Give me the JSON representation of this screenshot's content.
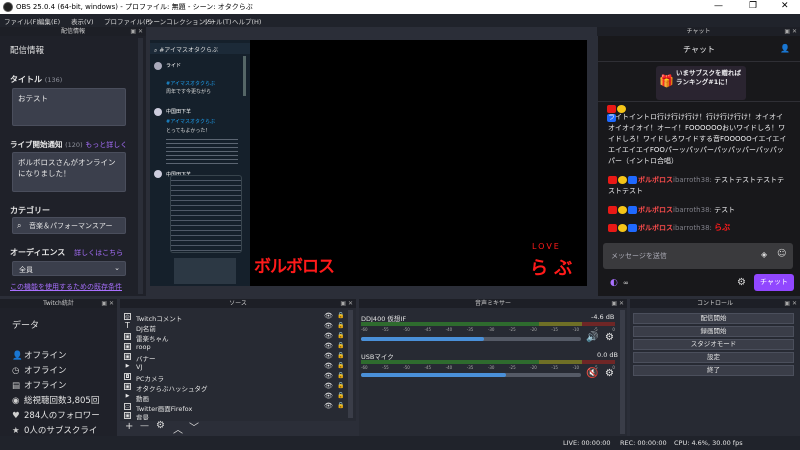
{
  "window": {
    "title": "OBS 25.0.4 (64-bit, windows) - プロファイル: 無題 - シーン: オタクらぶ",
    "controls": [
      "—",
      "❐",
      "✕"
    ]
  },
  "menu": [
    "ファイル(F)",
    "編集(E)",
    "表示(V)",
    "プロファイル(P)",
    "シーンコレクション(S)",
    "ツール(T)",
    "ヘルプ(H)"
  ],
  "stream_info": {
    "dock_title": "配信情報",
    "section_title": "配信情報",
    "title_label": "タイトル",
    "title_count": "(136)",
    "title_value": "おテスト",
    "notify_label": "ライブ開始通知",
    "notify_count": "(120)",
    "notify_more": "もっと詳しく",
    "notify_value": "ボルボロスさんがオンラインになりました！",
    "category_label": "カテゴリー",
    "category_value": "音楽＆パフォーマンスアー",
    "audience_label": "オーディエンス",
    "audience_more": "詳しくはこちら",
    "audience_value": "全員",
    "footer_text": "この機能を使用するための既存条件"
  },
  "preview": {
    "tweet_header": "#アイマスオタクらぶ",
    "tweet_names": [
      "ライド",
      "中国田下羊",
      "中国田下羊"
    ],
    "tweet_tags": [
      "#アイマスオタクらぶ",
      "#アイマスオタクらぶ"
    ],
    "tweet_text_1": "周年です今更ながら",
    "tweet_text_2": "とってもよかった！",
    "overlay_left": "ボルボロス",
    "overlay_love": "LOVE",
    "overlay_right": "ら ぶ"
  },
  "chat": {
    "dock_title": "チャット",
    "header": "チャット",
    "promo": "いまサブスクを贈ればランキング#1に！",
    "lines": [
      "ライトイントロ行け行け行け！行け行け行け！オイオイオイオイオイ！オーイ！FOOOOOOおいワイドしろ！ワイドしろ！ワイドしろワイドする音FOOOOOイエイエイエイエイエイFOOパーッパッパーパッパッパーパッパッパー（イントロ合唱）",
      "ボルボロス",
      "ibarroth38",
      "テストテストテストテストテスト",
      "ボルボロス",
      "ibarroth38",
      "テスト",
      "ボルボロス",
      "ibarroth38",
      "らぶ"
    ],
    "input_placeholder": "メッセージを送信",
    "points": "∞",
    "send_label": "チャット",
    "love_word": "らぶ"
  },
  "twitch_stats": {
    "dock_title": "Twitch統計",
    "tab": "データ",
    "rows": [
      "オフライン",
      "オフライン",
      "オフライン",
      "総視聴回数3,805回",
      "284人のフォロワー",
      "0人のサブスクライ"
    ]
  },
  "sources": {
    "dock_title": "ソース",
    "items": [
      "Twitchコメント",
      "DJ名前",
      "雷楽ちゃん",
      "roop",
      "バナー",
      "VJ",
      "PCカメラ",
      "オタクらぶハッシュタグ",
      "動画",
      "Twitter画面Firefox",
      "背景"
    ],
    "toolbar": [
      "+",
      "—",
      "⚙",
      "︿",
      "﹀"
    ]
  },
  "mixer": {
    "dock_title": "音声ミキサー",
    "tracks": [
      {
        "name": "DDJ400 仮想IF",
        "db": "-4.6 dB",
        "level": 0.56
      },
      {
        "name": "USBマイク",
        "db": "0.0 dB",
        "level": 0.66
      }
    ],
    "ticks": [
      "-60",
      "-55",
      "-50",
      "-45",
      "-40",
      "-35",
      "-30",
      "-25",
      "-20",
      "-15",
      "-10",
      "-5",
      "0"
    ]
  },
  "controls": {
    "dock_title": "コントロール",
    "buttons": [
      "配信開始",
      "録画開始",
      "スタジオモード",
      "設定",
      "終了"
    ]
  },
  "statusbar": {
    "live": "LIVE: 00:00:00",
    "rec": "REC: 00:00:00",
    "cpu": "CPU: 4.6%, 30.00 fps"
  },
  "colors": {
    "accent": "#9147ff",
    "overlay_red": "#ff1a1a",
    "username_red": "#ff4d4d",
    "meter_green": "#3db83d",
    "meter_yellow": "#c9c93a",
    "meter_red": "#c43a3a"
  }
}
